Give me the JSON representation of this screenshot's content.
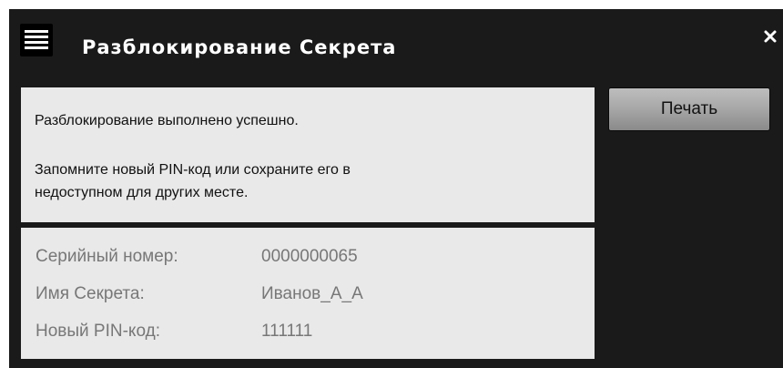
{
  "window": {
    "title": "Разблокирование Секрета",
    "menu_icon": "hamburger-menu-icon",
    "close_icon": "close-icon"
  },
  "message": {
    "line1": "Разблокирование выполнено успешно.",
    "line2": "Запомните новый PIN-код или сохраните его в",
    "line3": "недоступном для других месте."
  },
  "info": {
    "rows": [
      {
        "label": "Серийный номер:",
        "value": "0000000065"
      },
      {
        "label": "Имя Секрета:",
        "value": "Иванов_А_А"
      },
      {
        "label": "Новый PIN-код:",
        "value": "111111"
      }
    ]
  },
  "actions": {
    "print_label": "Печать"
  },
  "colors": {
    "window_bg": "#1a1a1a",
    "panel_bg": "#e9e9e9",
    "title_text": "#ffffff",
    "info_text": "#777777"
  }
}
